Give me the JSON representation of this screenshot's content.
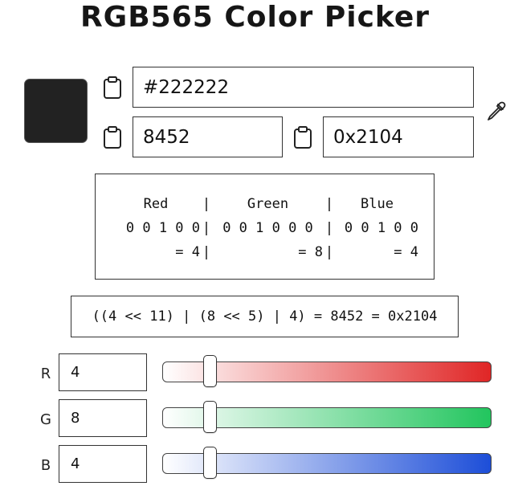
{
  "title": "RGB565 Color Picker",
  "color": {
    "swatch_hex": "#222222"
  },
  "fields": {
    "hex_value": "#222222",
    "decimal_value": "8452",
    "hex16_value": "0x2104"
  },
  "icons": {
    "copy": "clipboard-icon",
    "picker": "eyedropper-icon"
  },
  "bits": {
    "headers": [
      "Red",
      "Green",
      "Blue"
    ],
    "red_bits": "0 0 1 0 0",
    "green_bits": "0 0 1 0 0 0",
    "blue_bits": "0 0 1 0 0",
    "red_sum": "= 4",
    "green_sum": "= 8",
    "blue_sum": "= 4",
    "separator": "|"
  },
  "formula": "((4 << 11) | (8 << 5) | 4) = 8452 = 0x2104",
  "channels": [
    {
      "label": "R",
      "value": "4",
      "max": 31,
      "fraction": 0.129,
      "accent": "#e02626"
    },
    {
      "label": "G",
      "value": "8",
      "max": 63,
      "fraction": 0.127,
      "accent": "#22c55e"
    },
    {
      "label": "B",
      "value": "4",
      "max": 31,
      "fraction": 0.129,
      "accent": "#1d4ed8"
    }
  ]
}
